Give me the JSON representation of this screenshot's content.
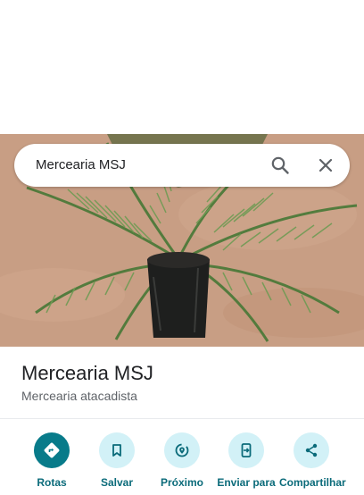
{
  "search": {
    "query": "Mercearia MSJ"
  },
  "place": {
    "name": "Mercearia MSJ",
    "category": "Mercearia atacadista"
  },
  "actions": [
    {
      "label": "Rotas",
      "icon": "directions-icon"
    },
    {
      "label": "Salvar",
      "icon": "bookmark-icon"
    },
    {
      "label": "Próximo",
      "icon": "nearby-icon"
    },
    {
      "label": "Enviar para",
      "icon": "send-to-device-icon"
    },
    {
      "label": "Compartilhar",
      "icon": "share-icon"
    }
  ],
  "colors": {
    "accent": "#087b8a",
    "action_bg": "#d2f1f7",
    "action_label": "#0b6b7a"
  }
}
